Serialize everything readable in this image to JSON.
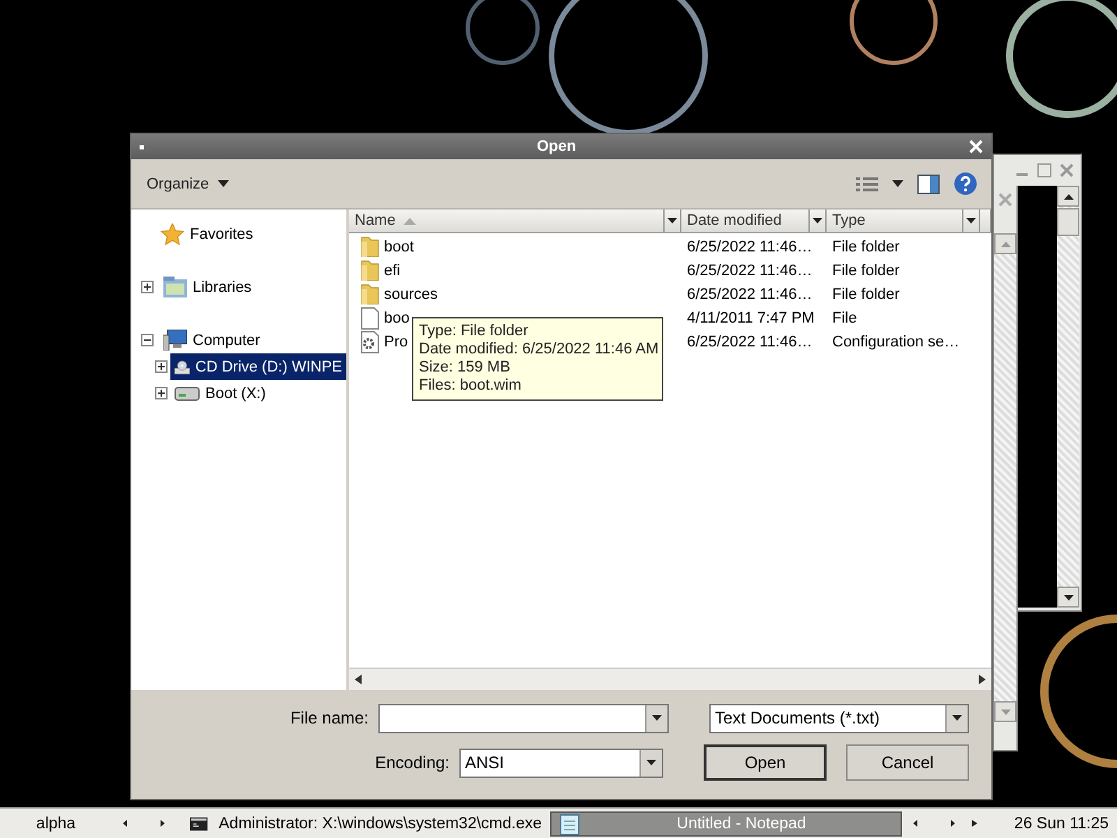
{
  "dialog": {
    "title": "Open",
    "toolbar": {
      "organize": "Organize"
    },
    "nav": [
      {
        "label": "Favorites",
        "kind": "star",
        "selected": false
      },
      {
        "label": "Libraries",
        "kind": "library",
        "expanded": false,
        "selected": false
      },
      {
        "label": "Computer",
        "kind": "computer",
        "expanded": true,
        "selected": false,
        "children": [
          {
            "label": "CD Drive (D:) WINPE",
            "kind": "cd",
            "expanded": false,
            "selected": true
          },
          {
            "label": "Boot (X:)",
            "kind": "drive",
            "expanded": false,
            "selected": false
          }
        ]
      }
    ],
    "columns": [
      {
        "label": "Name",
        "sorted": true
      },
      {
        "label": "Date modified",
        "sorted": false
      },
      {
        "label": "Type",
        "sorted": false
      }
    ],
    "rows": [
      {
        "name": "boot",
        "kind": "folder",
        "date": "6/25/2022 11:46…",
        "type": "File folder"
      },
      {
        "name": "efi",
        "kind": "folder",
        "date": "6/25/2022 11:46…",
        "type": "File folder"
      },
      {
        "name": "sources",
        "kind": "folder",
        "date": "6/25/2022 11:46…",
        "type": "File folder"
      },
      {
        "name": "boo",
        "kind": "file",
        "date": "4/11/2011 7:47 PM",
        "type": "File"
      },
      {
        "name": "Pro",
        "kind": "config",
        "date": "6/25/2022 11:46…",
        "type": "Configuration se…"
      }
    ],
    "tooltip": [
      "Type: File folder",
      "Date modified: 6/25/2022 11:46 AM",
      "Size: 159 MB",
      "Files: boot.wim"
    ],
    "footer": {
      "file_name_label": "File name:",
      "filter": "Text Documents (*.txt)",
      "encoding_label": "Encoding:",
      "encoding": "ANSI",
      "buttons": [
        "Open",
        "Cancel"
      ]
    }
  },
  "taskbar": {
    "workspace": "alpha",
    "tasks": [
      {
        "label": "Administrator: X:\\windows\\system32\\cmd.exe",
        "kind": "console",
        "selected": false
      },
      {
        "label": "Untitled - Notepad",
        "kind": "notepad",
        "selected": true
      }
    ],
    "clock": "26 Sun 11:25"
  }
}
